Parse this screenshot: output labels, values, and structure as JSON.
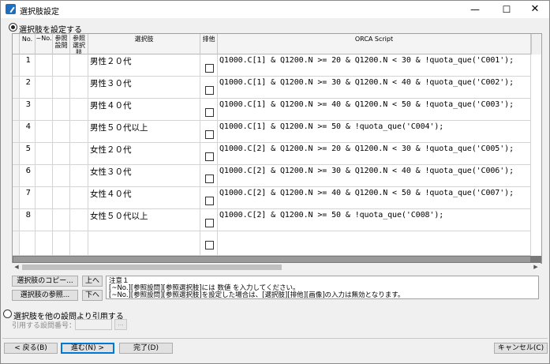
{
  "window": {
    "title": "選択肢設定",
    "icon": "app-icon"
  },
  "mode": {
    "set_label": "選択肢を設定する",
    "cite_label": "選択肢を他の設問より引用する",
    "selected": "set"
  },
  "grid": {
    "headers": {
      "no": "No.",
      "tilde_no": "~No.",
      "ref_question": "参照設問",
      "ref_choice": "参照選択肢",
      "choice": "選択肢",
      "exclusive": "排他",
      "script": "ORCA Script"
    },
    "rows": [
      {
        "no": "1",
        "choice": "男性２０代",
        "exclusive": false,
        "script": "Q1000.C[1] & Q1200.N >= 20 & Q1200.N < 30 & !quota_que('C001');"
      },
      {
        "no": "2",
        "choice": "男性３０代",
        "exclusive": false,
        "script": "Q1000.C[1] & Q1200.N >= 30 & Q1200.N < 40 & !quota_que('C002');"
      },
      {
        "no": "3",
        "choice": "男性４０代",
        "exclusive": false,
        "script": "Q1000.C[1] & Q1200.N >= 40 & Q1200.N < 50 & !quota_que('C003');"
      },
      {
        "no": "4",
        "choice": "男性５０代以上",
        "exclusive": false,
        "script": "Q1000.C[1] & Q1200.N >= 50 & !quota_que('C004');"
      },
      {
        "no": "5",
        "choice": "女性２０代",
        "exclusive": false,
        "script": "Q1000.C[2] & Q1200.N >= 20 & Q1200.N < 30 & !quota_que('C005');"
      },
      {
        "no": "6",
        "choice": "女性３０代",
        "exclusive": false,
        "script": "Q1000.C[2] & Q1200.N >= 30 & Q1200.N < 40 & !quota_que('C006');"
      },
      {
        "no": "7",
        "choice": "女性４０代",
        "exclusive": false,
        "script": "Q1000.C[2] & Q1200.N >= 40 & Q1200.N < 50 & !quota_que('C007');"
      },
      {
        "no": "8",
        "choice": "女性５０代以上",
        "exclusive": false,
        "script": "Q1000.C[2] & Q1200.N >= 50 & !quota_que('C008');"
      },
      {
        "no": "",
        "choice": "",
        "exclusive": false,
        "script": ""
      }
    ]
  },
  "tools": {
    "copy_label": "選択肢のコピー...",
    "ref_label": "選択肢の参照...",
    "up_label": "上へ",
    "down_label": "下へ"
  },
  "notes": {
    "line1": "注意１",
    "line2": "[~No.][参照設問][参照選択肢]には 数値 を入力してください。",
    "line3": "[~No.][参照設問][参照選択肢]を設定した場合は、[選択肢][排他][画像]の入力は無効となります。"
  },
  "cite": {
    "field_label": "引用する設問番号：",
    "browse_label": "..."
  },
  "footer": {
    "back_label": "< 戻る(B)",
    "next_label": "進む(N) >",
    "finish_label": "完了(D)",
    "cancel_label": "キャンセル(C)"
  }
}
